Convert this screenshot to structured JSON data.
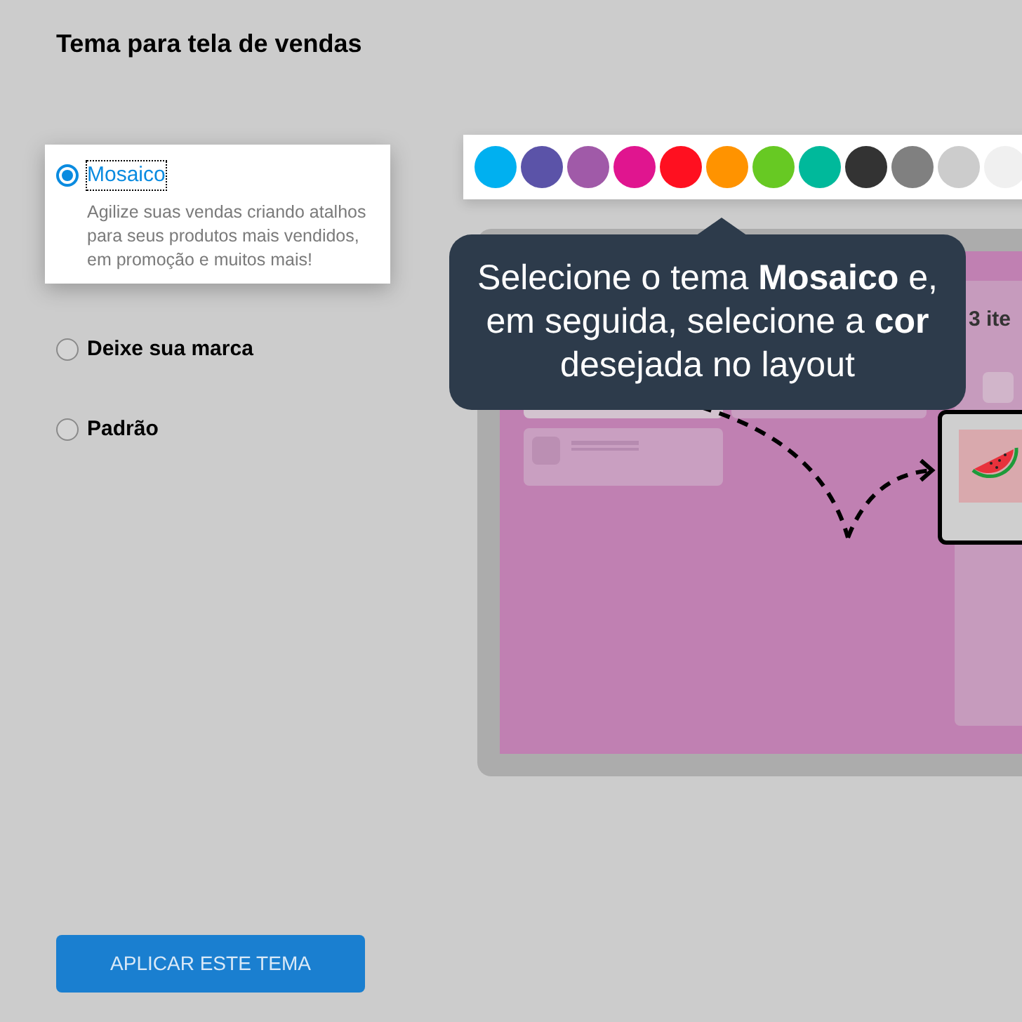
{
  "title": "Tema para tela de vendas",
  "themes": [
    {
      "label": "Mosaico",
      "selected": true,
      "description": "Agilize suas vendas criando atalhos para seus produtos mais vendidos, em promoção e muitos mais!"
    },
    {
      "label": "Deixe sua marca",
      "selected": false
    },
    {
      "label": "Padrão",
      "selected": false
    }
  ],
  "apply_button": "APLICAR ESTE TEMA",
  "palette": [
    {
      "color": "#00b0f0"
    },
    {
      "color": "#5b53a8"
    },
    {
      "color": "#a05aa8"
    },
    {
      "color": "#e0158f"
    },
    {
      "color": "#ff1020"
    },
    {
      "color": "#ff9300"
    },
    {
      "color": "#67c923"
    },
    {
      "color": "#00b99b"
    },
    {
      "color": "#333333"
    },
    {
      "color": "#808080"
    },
    {
      "color": "#cccccc"
    },
    {
      "color": "#f0f0f0"
    }
  ],
  "preview": {
    "cart_text": "3 ite"
  },
  "tooltip": "Selecione o tema **Mosaico** e, em seguida, selecione a **cor** desejada no layout"
}
